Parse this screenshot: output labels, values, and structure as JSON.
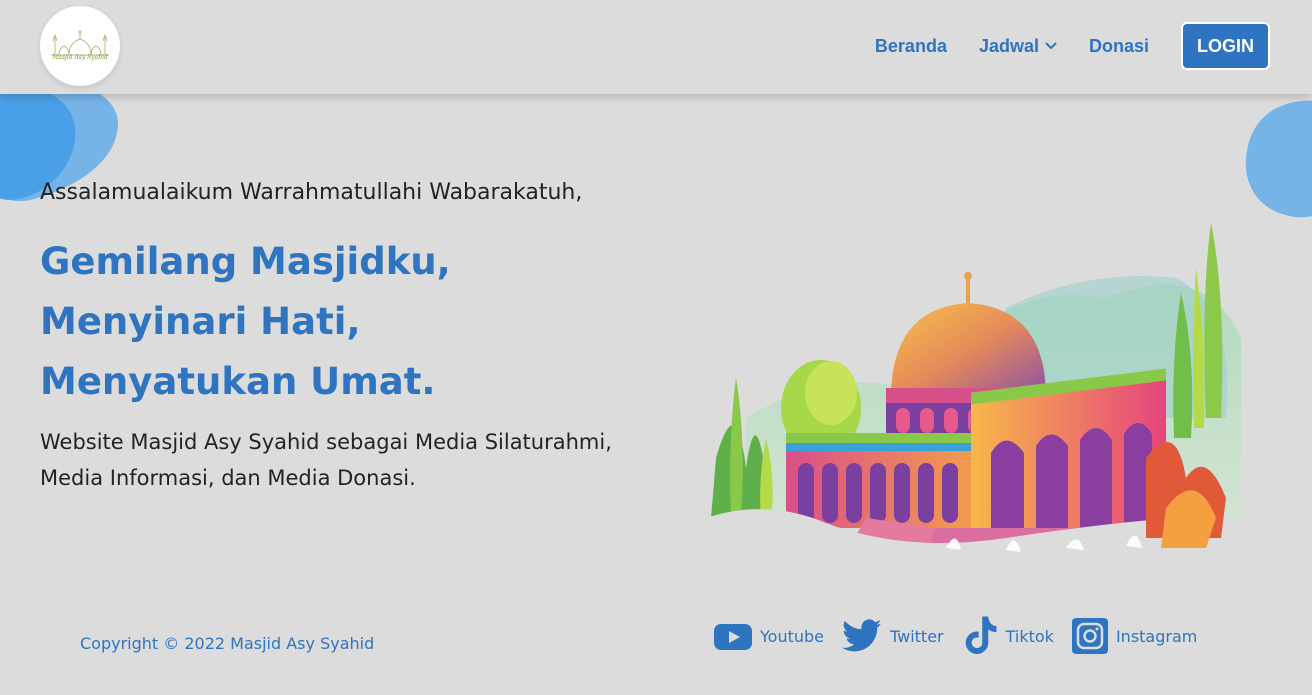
{
  "brand": {
    "logo_text": "Masjid Asy Syahid",
    "accent": "#2f74c0"
  },
  "nav": {
    "items": [
      {
        "label": "Beranda"
      },
      {
        "label": "Jadwal"
      },
      {
        "label": "Donasi"
      }
    ],
    "login_label": "LOGIN"
  },
  "hero": {
    "greeting": "Assalamualaikum Warrahmatullahi Wabarakatuh,",
    "headline": [
      "Gemilang Masjidku,",
      "Menyinari Hati,",
      "Menyatukan Umat."
    ],
    "description": "Website Masjid Asy Syahid sebagai Media Silaturahmi, Media Informasi, dan Media Donasi."
  },
  "footer": {
    "copyright": "Copyright © 2022 Masjid Asy Syahid",
    "socials": [
      {
        "label": "Youtube",
        "icon": "youtube-icon"
      },
      {
        "label": "Twitter",
        "icon": "twitter-icon"
      },
      {
        "label": "Tiktok",
        "icon": "tiktok-icon"
      },
      {
        "label": "Instagram",
        "icon": "instagram-icon"
      }
    ]
  }
}
